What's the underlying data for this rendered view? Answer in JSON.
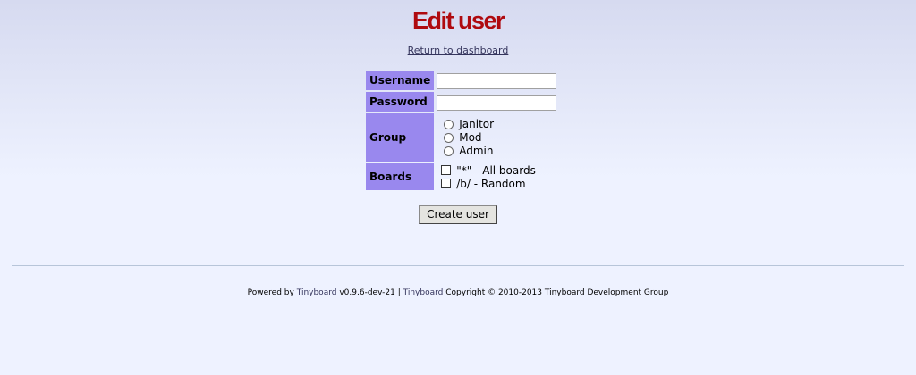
{
  "page": {
    "title": "Edit user",
    "return_link": "Return to dashboard"
  },
  "form": {
    "username_label": "Username",
    "username_value": "",
    "password_label": "Password",
    "password_value": "",
    "group_label": "Group",
    "groups": [
      "Janitor",
      "Mod",
      "Admin"
    ],
    "boards_label": "Boards",
    "boards": [
      "\"*\" - All boards",
      "/b/ - Random"
    ],
    "submit_label": "Create user"
  },
  "footer": {
    "powered_by": "Powered by",
    "link1": "Tinyboard",
    "version": "v0.9.6-dev-21 |",
    "link2": "Tinyboard",
    "copyright": "Copyright © 2010-2013 Tinyboard Development Group"
  },
  "colors": {
    "title": "#af0a0f",
    "label_bg": "#9988ee",
    "link": "#34345c"
  }
}
